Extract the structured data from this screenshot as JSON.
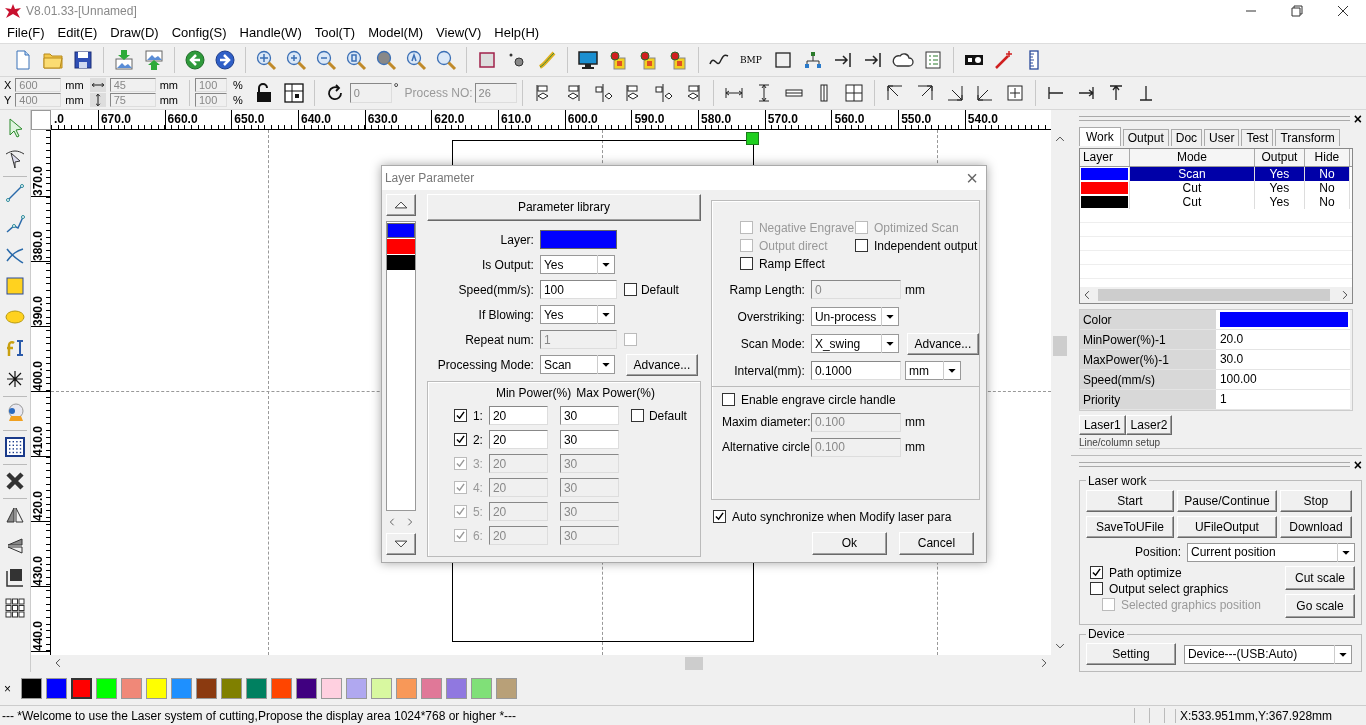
{
  "window": {
    "title": "V8.01.33-[Unnamed]"
  },
  "menu": [
    "File(F)",
    "Edit(E)",
    "Draw(D)",
    "Config(S)",
    "Handle(W)",
    "Tool(T)",
    "Model(M)",
    "View(V)",
    "Help(H)"
  ],
  "toolbar": {
    "bitmap_button": "BMP"
  },
  "position_bar": {
    "x": {
      "label": "X",
      "value": "600",
      "unit": "mm"
    },
    "y": {
      "label": "Y",
      "value": "400",
      "unit": "mm"
    },
    "width": {
      "value": "45",
      "unit": "mm"
    },
    "height": {
      "value": "75",
      "unit": "mm"
    },
    "scale_x": {
      "value": "100",
      "unit": "%"
    },
    "scale_y": {
      "value": "100",
      "unit": "%"
    },
    "rotation": {
      "value": "0",
      "unit": "°"
    },
    "process_no": {
      "label": "Process NO:",
      "value": "26"
    }
  },
  "rulers": {
    "horizontal": [
      ".0",
      "670.0",
      "660.0",
      "650.0",
      "640.0",
      "630.0",
      "620.0",
      "610.0",
      "600.0",
      "590.0",
      "580.0",
      "570.0",
      "560.0",
      "550.0",
      "540.0"
    ],
    "vertical": [
      "370.0",
      "380.0",
      "390.0",
      "400.0",
      "410.0",
      "420.0",
      "430.0",
      "440.0"
    ]
  },
  "dialog": {
    "title": "Layer Parameter",
    "close": "×",
    "layers": [
      {
        "color": "#0000ff",
        "selected": true
      },
      {
        "color": "#ff0000",
        "selected": false
      },
      {
        "color": "#000000",
        "selected": false
      }
    ],
    "library_button": "Parameter library",
    "fields": [
      {
        "kind": "color",
        "label": "Layer:",
        "color": "#0000ff"
      },
      {
        "kind": "select",
        "label": "Is Output:",
        "value": "Yes"
      },
      {
        "kind": "input",
        "label": "Speed(mm/s):",
        "value": "100",
        "disabled": false,
        "checkbox": {
          "label": "Default",
          "checked": false,
          "disabled": false
        }
      },
      {
        "kind": "select",
        "label": "If Blowing:",
        "value": "Yes"
      },
      {
        "kind": "input",
        "label": "Repeat num:",
        "value": "1",
        "disabled": true,
        "checkbox": {
          "checked": false,
          "disabled": true
        }
      },
      {
        "kind": "select",
        "label": "Processing Mode:",
        "value": "Scan",
        "button": "Advance..."
      }
    ],
    "power": {
      "min_header": "Min Power(%)",
      "max_header": "Max Power(%)",
      "default": {
        "label": "Default",
        "checked": false
      },
      "rows": [
        {
          "label": "1:",
          "checked": true,
          "disabled": false,
          "min": "20",
          "max": "30"
        },
        {
          "label": "2:",
          "checked": true,
          "disabled": false,
          "min": "20",
          "max": "30"
        },
        {
          "label": "3:",
          "checked": true,
          "disabled": true,
          "min": "20",
          "max": "30"
        },
        {
          "label": "4:",
          "checked": true,
          "disabled": true,
          "min": "20",
          "max": "30"
        },
        {
          "label": "5:",
          "checked": true,
          "disabled": true,
          "min": "20",
          "max": "30"
        },
        {
          "label": "6:",
          "checked": true,
          "disabled": true,
          "min": "20",
          "max": "30"
        }
      ]
    },
    "options": [
      {
        "label": "Negative Engrave",
        "checked": false,
        "disabled": true
      },
      {
        "label": "Optimized Scan",
        "checked": false,
        "disabled": true
      },
      {
        "label": "Output direct",
        "checked": false,
        "disabled": true
      },
      {
        "label": "Independent output",
        "checked": false,
        "disabled": false
      },
      {
        "label": "Ramp Effect",
        "checked": false,
        "disabled": false
      }
    ],
    "settings": [
      {
        "kind": "input",
        "label": "Ramp Length:",
        "value": "0",
        "unit": "mm",
        "disabled": true
      },
      {
        "kind": "select",
        "label": "Overstriking:",
        "value": "Un-process"
      },
      {
        "kind": "select",
        "label": "Scan Mode:",
        "value": "X_swing",
        "button": "Advance..."
      },
      {
        "kind": "input",
        "label": "Interval(mm):",
        "value": "0.1000",
        "unit_select": "mm",
        "disabled": false
      }
    ],
    "circle": {
      "enable": {
        "label": "Enable engrave circle handle",
        "checked": false
      },
      "fields": [
        {
          "label": "Maxim diameter:",
          "value": "0.100",
          "unit": "mm",
          "disabled": true
        },
        {
          "label": "Alternative circle",
          "value": "0.100",
          "unit": "mm",
          "disabled": true
        }
      ]
    },
    "auto_sync": {
      "label": "Auto synchronize when Modify laser para",
      "checked": true
    },
    "buttons": [
      "Ok",
      "Cancel"
    ]
  },
  "panel": {
    "close": "×",
    "tabs": [
      {
        "label": "Work",
        "selected": true
      },
      {
        "label": "Output",
        "selected": false
      },
      {
        "label": "Doc",
        "selected": false
      },
      {
        "label": "User",
        "selected": false
      },
      {
        "label": "Test",
        "selected": false
      },
      {
        "label": "Transform",
        "selected": false
      }
    ],
    "layer_table": {
      "columns": [
        "Layer",
        "Mode",
        "Output",
        "Hide"
      ],
      "rows": [
        {
          "color": "#0000ff",
          "mode": "Scan",
          "output": "Yes",
          "hide": "No",
          "selected": true
        },
        {
          "color": "#ff0000",
          "mode": "Cut",
          "output": "Yes",
          "hide": "No",
          "selected": false
        },
        {
          "color": "#000000",
          "mode": "Cut",
          "output": "Yes",
          "hide": "No",
          "selected": false
        }
      ]
    },
    "properties": [
      {
        "kind": "color",
        "label": "Color",
        "color": "#0000ff"
      },
      {
        "kind": "text",
        "label": "MinPower(%)-1",
        "value": "20.0"
      },
      {
        "kind": "text",
        "label": "MaxPower(%)-1",
        "value": "30.0"
      },
      {
        "kind": "text",
        "label": "Speed(mm/s)",
        "value": "100.00"
      },
      {
        "kind": "text",
        "label": "Priority",
        "value": "1"
      }
    ],
    "laser_tabs": [
      "Laser1",
      "Laser2"
    ],
    "next_group": "Line/column setup"
  },
  "work_panel": {
    "close": "×",
    "laser_work": {
      "title": "Laser work",
      "buttons": [
        "Start",
        "Pause/Continue",
        "Stop",
        "SaveToUFile",
        "UFileOutput",
        "Download"
      ],
      "position": {
        "label": "Position:",
        "value": "Current position"
      },
      "options": [
        {
          "label": "Path optimize",
          "checked": true,
          "disabled": false
        },
        {
          "label": "Output select graphics",
          "checked": false,
          "disabled": false
        },
        {
          "label": "Selected graphics position",
          "checked": false,
          "disabled": true
        }
      ],
      "scale_buttons": [
        "Cut scale",
        "Go scale"
      ]
    },
    "device": {
      "title": "Device",
      "button": "Setting",
      "value": "Device---(USB:Auto)"
    }
  },
  "palette": {
    "close": "×",
    "swatches": [
      {
        "color": "#000000",
        "selected": false
      },
      {
        "color": "#0000ff",
        "selected": false
      },
      {
        "color": "#ff0000",
        "selected": true
      },
      {
        "color": "#00ff00",
        "selected": false
      },
      {
        "color": "#f08878",
        "selected": false
      },
      {
        "color": "#ffff00",
        "selected": false
      },
      {
        "color": "#1e90ff",
        "selected": false
      },
      {
        "color": "#8b3a10",
        "selected": false
      },
      {
        "color": "#808000",
        "selected": false
      },
      {
        "color": "#008060",
        "selected": false
      },
      {
        "color": "#ff4500",
        "selected": false
      },
      {
        "color": "#400080",
        "selected": false
      },
      {
        "color": "#ffd0e0",
        "selected": false
      },
      {
        "color": "#b0a8f0",
        "selected": false
      },
      {
        "color": "#d8f8a0",
        "selected": false
      },
      {
        "color": "#f89858",
        "selected": false
      },
      {
        "color": "#e07898",
        "selected": false
      },
      {
        "color": "#9078e0",
        "selected": false
      },
      {
        "color": "#80e078",
        "selected": false
      },
      {
        "color": "#b8a078",
        "selected": false
      }
    ]
  },
  "status_bar": {
    "message": "--- *Welcome to use the Laser system of cutting,Propose the display area 1024*768 or higher *---",
    "coordinates": "X:533.951mm,Y:367.928mm"
  }
}
